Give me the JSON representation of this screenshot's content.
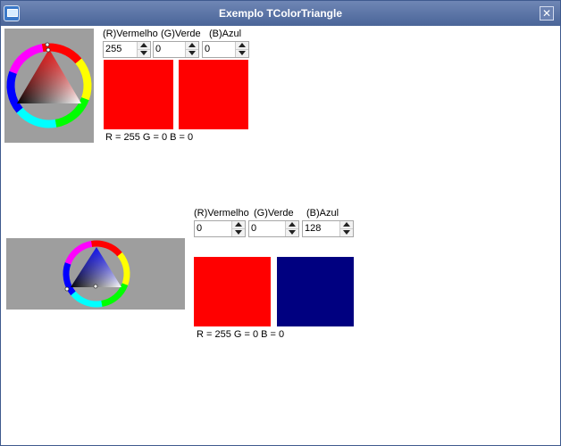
{
  "window": {
    "title": "Exemplo TColorTriangle"
  },
  "group1": {
    "labels": {
      "red": "(R)Vermelho",
      "green": "(G)Verde",
      "blue": "(B)Azul"
    },
    "values": {
      "red": "255",
      "green": "0",
      "blue": "0"
    },
    "swatch_left_color": "#ff0000",
    "swatch_right_color": "#ff0000",
    "summary": "R = 255 G = 0 B = 0"
  },
  "group2": {
    "labels": {
      "red": "(R)Vermelho",
      "green": "(G)Verde",
      "blue": "(B)Azul"
    },
    "values": {
      "red": "0",
      "green": "0",
      "blue": "128"
    },
    "swatch_left_color": "#ff0000",
    "swatch_right_color": "#000080",
    "summary": "R = 255 G = 0 B = 0"
  },
  "icons": {
    "window_icon": "app-window-icon",
    "close": "close-icon",
    "spin_up": "arrow-up-icon",
    "spin_down": "arrow-down-icon"
  },
  "colors": {
    "titlebar": "#4a6598",
    "panel": "#9e9e9e"
  }
}
